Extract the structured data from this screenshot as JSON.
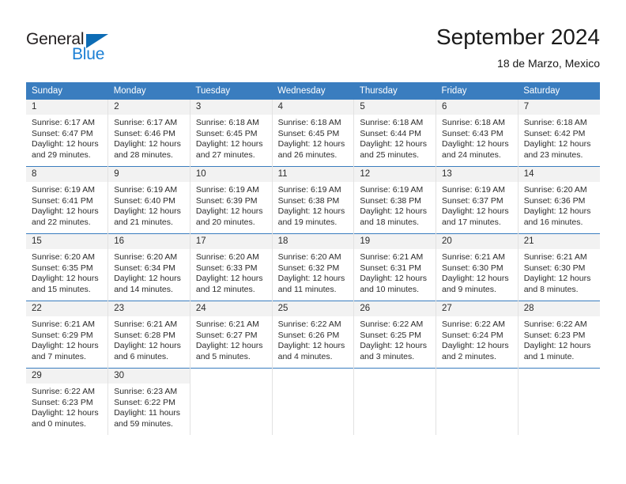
{
  "brand": {
    "name_part1": "General",
    "name_part2": "Blue",
    "triangle_color": "#0d6cb5",
    "blue_color": "#1b7fd4"
  },
  "header": {
    "month_title": "September 2024",
    "location": "18 de Marzo, Mexico"
  },
  "theme": {
    "header_blue": "#3a7dbf",
    "daynum_band": "#f2f2f2",
    "cell_divider": "#e2e2e2",
    "week_divider": "#3a7dbf",
    "text": "#2b2b2b"
  },
  "weekday_headers": [
    "Sunday",
    "Monday",
    "Tuesday",
    "Wednesday",
    "Thursday",
    "Friday",
    "Saturday"
  ],
  "weeks": [
    [
      {
        "day": "1",
        "sunrise": "Sunrise: 6:17 AM",
        "sunset": "Sunset: 6:47 PM",
        "daylight1": "Daylight: 12 hours",
        "daylight2": "and 29 minutes."
      },
      {
        "day": "2",
        "sunrise": "Sunrise: 6:17 AM",
        "sunset": "Sunset: 6:46 PM",
        "daylight1": "Daylight: 12 hours",
        "daylight2": "and 28 minutes."
      },
      {
        "day": "3",
        "sunrise": "Sunrise: 6:18 AM",
        "sunset": "Sunset: 6:45 PM",
        "daylight1": "Daylight: 12 hours",
        "daylight2": "and 27 minutes."
      },
      {
        "day": "4",
        "sunrise": "Sunrise: 6:18 AM",
        "sunset": "Sunset: 6:45 PM",
        "daylight1": "Daylight: 12 hours",
        "daylight2": "and 26 minutes."
      },
      {
        "day": "5",
        "sunrise": "Sunrise: 6:18 AM",
        "sunset": "Sunset: 6:44 PM",
        "daylight1": "Daylight: 12 hours",
        "daylight2": "and 25 minutes."
      },
      {
        "day": "6",
        "sunrise": "Sunrise: 6:18 AM",
        "sunset": "Sunset: 6:43 PM",
        "daylight1": "Daylight: 12 hours",
        "daylight2": "and 24 minutes."
      },
      {
        "day": "7",
        "sunrise": "Sunrise: 6:18 AM",
        "sunset": "Sunset: 6:42 PM",
        "daylight1": "Daylight: 12 hours",
        "daylight2": "and 23 minutes."
      }
    ],
    [
      {
        "day": "8",
        "sunrise": "Sunrise: 6:19 AM",
        "sunset": "Sunset: 6:41 PM",
        "daylight1": "Daylight: 12 hours",
        "daylight2": "and 22 minutes."
      },
      {
        "day": "9",
        "sunrise": "Sunrise: 6:19 AM",
        "sunset": "Sunset: 6:40 PM",
        "daylight1": "Daylight: 12 hours",
        "daylight2": "and 21 minutes."
      },
      {
        "day": "10",
        "sunrise": "Sunrise: 6:19 AM",
        "sunset": "Sunset: 6:39 PM",
        "daylight1": "Daylight: 12 hours",
        "daylight2": "and 20 minutes."
      },
      {
        "day": "11",
        "sunrise": "Sunrise: 6:19 AM",
        "sunset": "Sunset: 6:38 PM",
        "daylight1": "Daylight: 12 hours",
        "daylight2": "and 19 minutes."
      },
      {
        "day": "12",
        "sunrise": "Sunrise: 6:19 AM",
        "sunset": "Sunset: 6:38 PM",
        "daylight1": "Daylight: 12 hours",
        "daylight2": "and 18 minutes."
      },
      {
        "day": "13",
        "sunrise": "Sunrise: 6:19 AM",
        "sunset": "Sunset: 6:37 PM",
        "daylight1": "Daylight: 12 hours",
        "daylight2": "and 17 minutes."
      },
      {
        "day": "14",
        "sunrise": "Sunrise: 6:20 AM",
        "sunset": "Sunset: 6:36 PM",
        "daylight1": "Daylight: 12 hours",
        "daylight2": "and 16 minutes."
      }
    ],
    [
      {
        "day": "15",
        "sunrise": "Sunrise: 6:20 AM",
        "sunset": "Sunset: 6:35 PM",
        "daylight1": "Daylight: 12 hours",
        "daylight2": "and 15 minutes."
      },
      {
        "day": "16",
        "sunrise": "Sunrise: 6:20 AM",
        "sunset": "Sunset: 6:34 PM",
        "daylight1": "Daylight: 12 hours",
        "daylight2": "and 14 minutes."
      },
      {
        "day": "17",
        "sunrise": "Sunrise: 6:20 AM",
        "sunset": "Sunset: 6:33 PM",
        "daylight1": "Daylight: 12 hours",
        "daylight2": "and 12 minutes."
      },
      {
        "day": "18",
        "sunrise": "Sunrise: 6:20 AM",
        "sunset": "Sunset: 6:32 PM",
        "daylight1": "Daylight: 12 hours",
        "daylight2": "and 11 minutes."
      },
      {
        "day": "19",
        "sunrise": "Sunrise: 6:21 AM",
        "sunset": "Sunset: 6:31 PM",
        "daylight1": "Daylight: 12 hours",
        "daylight2": "and 10 minutes."
      },
      {
        "day": "20",
        "sunrise": "Sunrise: 6:21 AM",
        "sunset": "Sunset: 6:30 PM",
        "daylight1": "Daylight: 12 hours",
        "daylight2": "and 9 minutes."
      },
      {
        "day": "21",
        "sunrise": "Sunrise: 6:21 AM",
        "sunset": "Sunset: 6:30 PM",
        "daylight1": "Daylight: 12 hours",
        "daylight2": "and 8 minutes."
      }
    ],
    [
      {
        "day": "22",
        "sunrise": "Sunrise: 6:21 AM",
        "sunset": "Sunset: 6:29 PM",
        "daylight1": "Daylight: 12 hours",
        "daylight2": "and 7 minutes."
      },
      {
        "day": "23",
        "sunrise": "Sunrise: 6:21 AM",
        "sunset": "Sunset: 6:28 PM",
        "daylight1": "Daylight: 12 hours",
        "daylight2": "and 6 minutes."
      },
      {
        "day": "24",
        "sunrise": "Sunrise: 6:21 AM",
        "sunset": "Sunset: 6:27 PM",
        "daylight1": "Daylight: 12 hours",
        "daylight2": "and 5 minutes."
      },
      {
        "day": "25",
        "sunrise": "Sunrise: 6:22 AM",
        "sunset": "Sunset: 6:26 PM",
        "daylight1": "Daylight: 12 hours",
        "daylight2": "and 4 minutes."
      },
      {
        "day": "26",
        "sunrise": "Sunrise: 6:22 AM",
        "sunset": "Sunset: 6:25 PM",
        "daylight1": "Daylight: 12 hours",
        "daylight2": "and 3 minutes."
      },
      {
        "day": "27",
        "sunrise": "Sunrise: 6:22 AM",
        "sunset": "Sunset: 6:24 PM",
        "daylight1": "Daylight: 12 hours",
        "daylight2": "and 2 minutes."
      },
      {
        "day": "28",
        "sunrise": "Sunrise: 6:22 AM",
        "sunset": "Sunset: 6:23 PM",
        "daylight1": "Daylight: 12 hours",
        "daylight2": "and 1 minute."
      }
    ],
    [
      {
        "day": "29",
        "sunrise": "Sunrise: 6:22 AM",
        "sunset": "Sunset: 6:23 PM",
        "daylight1": "Daylight: 12 hours",
        "daylight2": "and 0 minutes."
      },
      {
        "day": "30",
        "sunrise": "Sunrise: 6:23 AM",
        "sunset": "Sunset: 6:22 PM",
        "daylight1": "Daylight: 11 hours",
        "daylight2": "and 59 minutes."
      },
      null,
      null,
      null,
      null,
      null
    ]
  ]
}
